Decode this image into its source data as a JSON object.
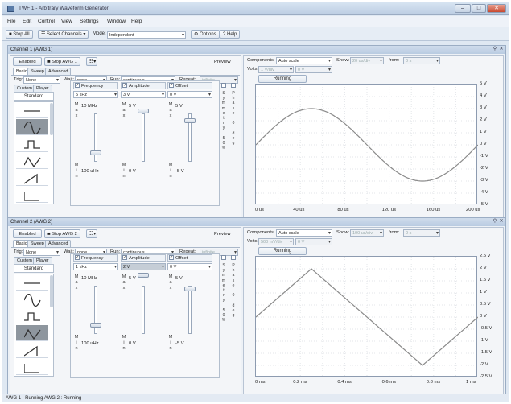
{
  "window": {
    "title": "TWF 1 - Arbitrary Waveform Generator",
    "minimize": "–",
    "maximize": "□",
    "close": "✕"
  },
  "menu": [
    "File",
    "Edit",
    "Control",
    "View",
    "Settings",
    "Window",
    "Help"
  ],
  "toolbar": {
    "stop_all": "Stop All",
    "select_channels": "Select Channels",
    "mode_label": "Mode:",
    "mode_value": "Independent",
    "options": "Options",
    "help": "Help"
  },
  "channels": [
    {
      "header": "Channel 1 (AWG 1)",
      "enabled": "Enabled",
      "stop": "Stop AWG 1",
      "preview": "Preview",
      "tabs": [
        "Basic",
        "Sweep",
        "Advanced"
      ],
      "trig_label": "Trig:",
      "trig_value": "None",
      "wait_label": "Wait:",
      "wait_value": "none",
      "run_label": "Run:",
      "run_value": "continuous",
      "repeat_label": "Repeat:",
      "repeat_value": "infinite",
      "wave_tabs": [
        "Custom",
        "Player"
      ],
      "standard": "Standard",
      "frequency": {
        "label": "Frequency",
        "value": "5 kHz",
        "max": "10 MHz",
        "min": "100 uHz"
      },
      "amplitude": {
        "label": "Amplitude",
        "value": "3 V",
        "max": "5 V",
        "min": "0 V"
      },
      "offset": {
        "label": "Offset",
        "value": "0 V",
        "max": "5 V",
        "min": "-5 V"
      },
      "symmetry": "Symmetry 50%",
      "phase": "Phase 0 deg",
      "scope": {
        "components_label": "Components:",
        "components_value": "Auto scale",
        "show_label": "Show:",
        "show_value": "20 us/div",
        "from_label": "from:",
        "from_value": "0 s",
        "volts_label": "Volts:",
        "volts_value": "1 V/div",
        "volts_offset": "0 V",
        "running": "Running",
        "y_ticks": [
          "5 V",
          "4 V",
          "3 V",
          "2 V",
          "1 V",
          "0 V",
          "-1 V",
          "-2 V",
          "-3 V",
          "-4 V",
          "-5 V"
        ],
        "x_ticks": [
          "0 us",
          "40 us",
          "80 us",
          "120 us",
          "160 us",
          "200 us"
        ]
      }
    },
    {
      "header": "Channel 2 (AWG 2)",
      "enabled": "Enabled",
      "stop": "Stop AWG 2",
      "preview": "Preview",
      "tabs": [
        "Basic",
        "Sweep",
        "Advanced"
      ],
      "trig_label": "Trig:",
      "trig_value": "None",
      "wait_label": "Wait:",
      "wait_value": "none",
      "run_label": "Run:",
      "run_value": "continuous",
      "repeat_label": "Repeat:",
      "repeat_value": "infinite",
      "wave_tabs": [
        "Custom",
        "Player"
      ],
      "standard": "Standard",
      "frequency": {
        "label": "Frequency",
        "value": "1 kHz",
        "max": "10 MHz",
        "min": "100 uHz"
      },
      "amplitude": {
        "label": "Amplitude",
        "value": "2 V",
        "max": "5 V",
        "min": "0 V"
      },
      "offset": {
        "label": "Offset",
        "value": "0 V",
        "max": "5 V",
        "min": "-5 V"
      },
      "symmetry": "Symmetry 50%",
      "phase": "Phase 0 deg",
      "scope": {
        "components_label": "Components:",
        "components_value": "Auto scale",
        "show_label": "Show:",
        "show_value": "100 us/div",
        "from_label": "from:",
        "from_value": "0 s",
        "volts_label": "Volts:",
        "volts_value": "500 mV/div",
        "volts_offset": "0 V",
        "running": "Running",
        "y_ticks": [
          "2.5 V",
          "2 V",
          "1.5 V",
          "1 V",
          "0.5 V",
          "0 V",
          "-0.5 V",
          "-1 V",
          "-1.5 V",
          "-2 V",
          "-2.5 V"
        ],
        "x_ticks": [
          "0 ms",
          "0.2 ms",
          "0.4 ms",
          "0.6 ms",
          "0.8 ms",
          "1 ms"
        ]
      }
    }
  ],
  "status": "AWG 1 : Running  AWG 2 : Running"
}
